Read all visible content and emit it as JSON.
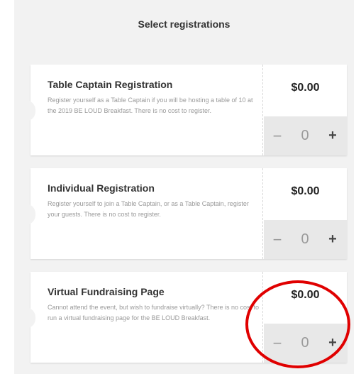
{
  "page": {
    "heading": "Select registrations"
  },
  "registrations": [
    {
      "title": "Table Captain Registration",
      "description": "Register yourself as a Table Captain if you will be hosting a table of 10 at the 2019 BE LOUD Breakfast. There is no cost to register.",
      "price": "$0.00",
      "quantity": "0",
      "minus": "−",
      "plus": "+"
    },
    {
      "title": "Individual Registration",
      "description": "Register yourself to join a Table Captain, or as a Table Captain, register your guests. There is no cost to register.",
      "price": "$0.00",
      "quantity": "0",
      "minus": "−",
      "plus": "+"
    },
    {
      "title": "Virtual Fundraising Page",
      "description": "Cannot attend the event, but wish to fundraise virtually? There is no cost to run a virtual fundraising page for the BE LOUD Breakfast.",
      "price": "$0.00",
      "quantity": "0",
      "minus": "−",
      "plus": "+"
    }
  ],
  "colors": {
    "highlight_circle": "#e00000",
    "panel_bg": "#f2f2f2",
    "stepper_bg": "#e8e8e8"
  }
}
